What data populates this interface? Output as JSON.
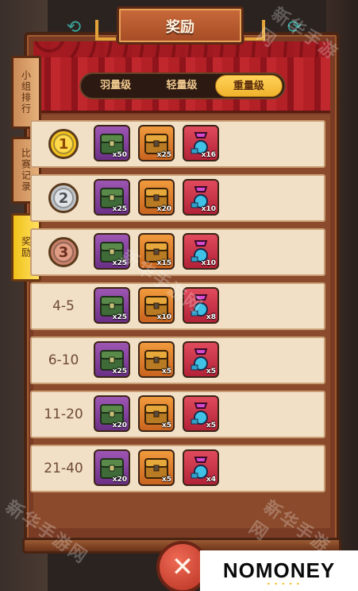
{
  "title": "奖励",
  "tabs": [
    {
      "label": "羽量级",
      "active": false
    },
    {
      "label": "轻量级",
      "active": false
    },
    {
      "label": "重量级",
      "active": true
    }
  ],
  "side_tabs": [
    {
      "label": "小组排行",
      "active": false
    },
    {
      "label": "比赛记录",
      "active": false
    },
    {
      "label": "奖励",
      "active": true
    }
  ],
  "rows": [
    {
      "rank": "1",
      "medal": "gold",
      "items": [
        "x50",
        "x25",
        "x16"
      ]
    },
    {
      "rank": "2",
      "medal": "silver",
      "items": [
        "x25",
        "x20",
        "x10"
      ]
    },
    {
      "rank": "3",
      "medal": "bronze",
      "items": [
        "x25",
        "x15",
        "x10"
      ]
    },
    {
      "rank": "4-5",
      "items": [
        "x25",
        "x10",
        "x8"
      ]
    },
    {
      "rank": "6-10",
      "items": [
        "x25",
        "x5",
        "x5"
      ]
    },
    {
      "rank": "11-20",
      "items": [
        "x20",
        "x5",
        "x5"
      ]
    },
    {
      "rank": "21-40",
      "items": [
        "x20",
        "x5",
        "x4"
      ]
    }
  ],
  "icons": {
    "close": "close-icon",
    "top_left": "arrow-icon",
    "top_right": "arrow-icon",
    "items": [
      "green-chest-icon",
      "gold-chest-icon",
      "pink-potion-icon"
    ]
  },
  "watermark": "新华手游网",
  "brand_logo": "NOMONEY",
  "colors": {
    "tab_active": "#f0b22c",
    "side_tab_active": "#f0c21a",
    "close_button": "#d04a35"
  }
}
